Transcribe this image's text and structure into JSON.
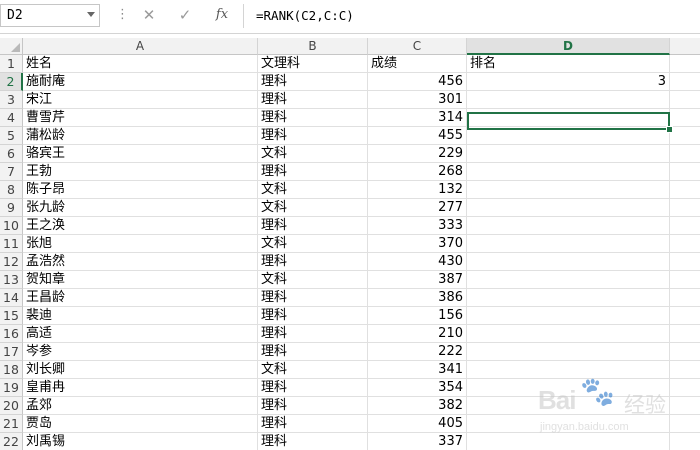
{
  "formula_bar": {
    "name_box": "D2",
    "formula": "=RANK(C2,C:C)",
    "sep": "⋮",
    "cancel_icon": "✕",
    "enter_icon": "✓",
    "fx_label": "fx"
  },
  "columns": [
    "A",
    "B",
    "C",
    "D"
  ],
  "rows": [
    {
      "n": "1",
      "a": "姓名",
      "b": "文理科",
      "c": "成绩",
      "d": "排名"
    },
    {
      "n": "2",
      "a": "施耐庵",
      "b": "理科",
      "c": "456",
      "d": "3"
    },
    {
      "n": "3",
      "a": "宋江",
      "b": "理科",
      "c": "301",
      "d": ""
    },
    {
      "n": "4",
      "a": "曹雪芹",
      "b": "理科",
      "c": "314",
      "d": ""
    },
    {
      "n": "5",
      "a": "蒲松龄",
      "b": "理科",
      "c": "455",
      "d": ""
    },
    {
      "n": "6",
      "a": "骆宾王",
      "b": "文科",
      "c": "229",
      "d": ""
    },
    {
      "n": "7",
      "a": "王勃",
      "b": "理科",
      "c": "268",
      "d": ""
    },
    {
      "n": "8",
      "a": "陈子昂",
      "b": "文科",
      "c": "132",
      "d": ""
    },
    {
      "n": "9",
      "a": "张九龄",
      "b": "文科",
      "c": "277",
      "d": ""
    },
    {
      "n": "10",
      "a": "王之涣",
      "b": "理科",
      "c": "333",
      "d": ""
    },
    {
      "n": "11",
      "a": "张旭",
      "b": "文科",
      "c": "370",
      "d": ""
    },
    {
      "n": "12",
      "a": "孟浩然",
      "b": "理科",
      "c": "430",
      "d": ""
    },
    {
      "n": "13",
      "a": "贺知章",
      "b": "文科",
      "c": "387",
      "d": ""
    },
    {
      "n": "14",
      "a": "王昌龄",
      "b": "理科",
      "c": "386",
      "d": ""
    },
    {
      "n": "15",
      "a": "裴迪",
      "b": "理科",
      "c": "156",
      "d": ""
    },
    {
      "n": "16",
      "a": "高适",
      "b": "理科",
      "c": "210",
      "d": ""
    },
    {
      "n": "17",
      "a": "岑参",
      "b": "理科",
      "c": "222",
      "d": ""
    },
    {
      "n": "18",
      "a": "刘长卿",
      "b": "文科",
      "c": "341",
      "d": ""
    },
    {
      "n": "19",
      "a": "皇甫冉",
      "b": "理科",
      "c": "354",
      "d": ""
    },
    {
      "n": "20",
      "a": "孟郊",
      "b": "理科",
      "c": "382",
      "d": ""
    },
    {
      "n": "21",
      "a": "贾岛",
      "b": "理科",
      "c": "405",
      "d": ""
    },
    {
      "n": "22",
      "a": "刘禹锡",
      "b": "理科",
      "c": "337",
      "d": ""
    }
  ],
  "watermark": {
    "logo": "Bai",
    "paw": "🐾",
    "text": "经验",
    "url": "jingyan.baidu.com"
  },
  "colors": {
    "accent": "#217346"
  }
}
